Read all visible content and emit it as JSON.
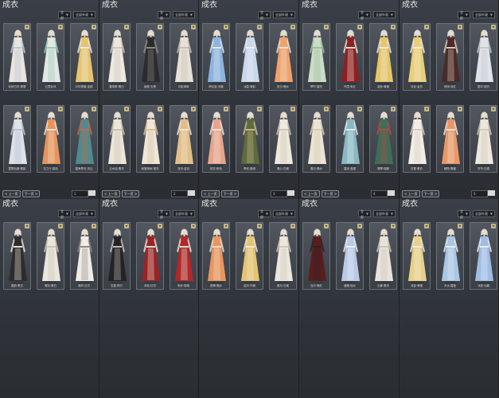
{
  "panel_title": "成衣",
  "filter_left": "全部",
  "filter_right": "全部外观",
  "pager": {
    "prev": "< 上一页",
    "next": "下一页 >"
  },
  "panels": [
    {
      "page_num": "1",
      "items": [
        {
          "name": "仙侠白衣·素雪",
          "dress": "#e9e4dc",
          "accent": "#b9c7d6",
          "badge": "★"
        },
        {
          "name": "云霞仙衣",
          "dress": "#dfe9e2",
          "accent": "#9fc9b6",
          "badge": "★"
        },
        {
          "name": "月华霓裳·金缕",
          "dress": "#e6c470",
          "accent": "#f0ece2",
          "badge": "★"
        },
        {
          "name": "霜雪仙裳·素影",
          "dress": "#dde2ea",
          "accent": "#b8c1cf",
          "badge": "★"
        },
        {
          "name": "花之行·暮色",
          "dress": "#e7945c",
          "accent": "#f1e4d2",
          "badge": "★"
        },
        {
          "name": "碧海青天·流云",
          "dress": "#4f8b8e",
          "accent": "#c36a4a",
          "badge": "★"
        }
      ]
    },
    {
      "page_num": "2",
      "items": [
        {
          "name": "春风醉·素白",
          "dress": "#ede8e0",
          "accent": "#cfc6b8",
          "badge": "★"
        },
        {
          "name": "幽夜·玄黑",
          "dress": "#2b2b2f",
          "accent": "#8e8a82",
          "badge": "★"
        },
        {
          "name": "月影清辉",
          "dress": "#e6e1d8",
          "accent": "#c7bfb3",
          "badge": "★"
        },
        {
          "name": "云水谣·素衣",
          "dress": "#ece6da",
          "accent": "#cdbfa8",
          "badge": "★"
        },
        {
          "name": "雨落清秋·锦衣",
          "dress": "#efe6d8",
          "accent": "#d8c09a",
          "badge": "★"
        },
        {
          "name": "流光·金羽",
          "dress": "#e2bf8a",
          "accent": "#f3e7d3",
          "badge": "★"
        }
      ]
    },
    {
      "page_num": "3",
      "items": [
        {
          "name": "晴空蓝·浅裳",
          "dress": "#8db4df",
          "accent": "#dfe8f2",
          "badge": "★"
        },
        {
          "name": "冰霜·清影",
          "dress": "#c9d7ea",
          "accent": "#edf1f6",
          "badge": "★"
        },
        {
          "name": "夏日·橙纱",
          "dress": "#efa26c",
          "accent": "#f3e2cf",
          "badge": "★"
        },
        {
          "name": "桃花·粉色",
          "dress": "#e7a48d",
          "accent": "#f4e5da",
          "badge": "★"
        },
        {
          "name": "青松·墨绿",
          "dress": "#5f6a3d",
          "accent": "#c9b993",
          "badge": "★"
        },
        {
          "name": "素心·白裳",
          "dress": "#eee8dd",
          "accent": "#cfc4b3",
          "badge": "★"
        }
      ]
    },
    {
      "page_num": "4",
      "items": [
        {
          "name": "翠竹·碧衣",
          "dress": "#cbdcc8",
          "accent": "#9fbf9a",
          "badge": "★"
        },
        {
          "name": "丹霞·朱红",
          "dress": "#8e1f22",
          "accent": "#e7ddd0",
          "badge": "★"
        },
        {
          "name": "金秋·黄裳",
          "dress": "#e6c66a",
          "accent": "#f1eadc",
          "badge": "★"
        },
        {
          "name": "春日·素纱",
          "dress": "#ebe4d6",
          "accent": "#d7c9ae",
          "badge": "★"
        },
        {
          "name": "碧波·蓝裙",
          "dress": "#8ab8c2",
          "accent": "#e1edf0",
          "badge": "★"
        },
        {
          "name": "翡翠·锦服",
          "dress": "#3d6e5a",
          "accent": "#b84a3c",
          "badge": "★"
        }
      ]
    },
    {
      "page_num": "5",
      "items": [
        {
          "name": "月桂·金衣",
          "dress": "#e8cf78",
          "accent": "#f4ecd9",
          "badge": "★"
        },
        {
          "name": "夜雨·深红",
          "dress": "#4b2a2a",
          "accent": "#d9c8b5",
          "badge": "★"
        },
        {
          "name": "霜华·银衣",
          "dress": "#dfe2e6",
          "accent": "#c4c9d0",
          "badge": "★"
        },
        {
          "name": "白雪·素衣",
          "dress": "#f1ede6",
          "accent": "#d5cdbf",
          "badge": "★"
        },
        {
          "name": "朝阳·橙裳",
          "dress": "#e89868",
          "accent": "#f3e3d0",
          "badge": "★"
        },
        {
          "name": "芳华·白裙",
          "dress": "#ece6dd",
          "accent": "#d2c7b6",
          "badge": "★"
        }
      ]
    },
    {
      "page_num": "",
      "items": [
        {
          "name": "墨韵·黑白",
          "dress": "#2d2b2b",
          "accent": "#e6e0d6",
          "badge": "★"
        },
        {
          "name": "雪羽·素白",
          "dress": "#ebe6dd",
          "accent": "#cbc2b3",
          "badge": "★"
        },
        {
          "name": "清风·白衣",
          "dress": "#f0ece5",
          "accent": "#8e8a82",
          "badge": "★"
        }
      ]
    },
    {
      "page_num": "",
      "items": [
        {
          "name": "玄墨·夜行",
          "dress": "#232325",
          "accent": "#c2bdb4",
          "badge": "★"
        },
        {
          "name": "赤焰·红衣",
          "dress": "#9a2326",
          "accent": "#ece3d6",
          "badge": "★"
        },
        {
          "name": "朱砂·锦袍",
          "dress": "#b3262a",
          "accent": "#e9dfcf",
          "badge": "★"
        }
      ]
    },
    {
      "page_num": "",
      "items": [
        {
          "name": "夏蝉·橙纱",
          "dress": "#e9955e",
          "accent": "#f1e0cb",
          "badge": "★"
        },
        {
          "name": "金凤·华服",
          "dress": "#e3c471",
          "accent": "#f2ead9",
          "badge": "★"
        },
        {
          "name": "素月·白裳",
          "dress": "#ece7de",
          "accent": "#d1c6b5",
          "badge": "★"
        }
      ]
    },
    {
      "page_num": "",
      "items": [
        {
          "name": "血月·暗红",
          "dress": "#5a1d1f",
          "accent": "#2b2526",
          "badge": "★"
        },
        {
          "name": "蓝蝶·轻纱",
          "dress": "#b9c9e6",
          "accent": "#eef1f7",
          "badge": "★"
        },
        {
          "name": "云裳·素衣",
          "dress": "#e7e3dc",
          "accent": "#cdc4b5",
          "badge": "★"
        }
      ]
    },
    {
      "page_num": "",
      "items": [
        {
          "name": "流金·黄裙",
          "dress": "#e9d08a",
          "accent": "#f4edde",
          "badge": "★"
        },
        {
          "name": "天水·碧蓝",
          "dress": "#a9c6e2",
          "accent": "#e5eef6",
          "badge": "★"
        },
        {
          "name": "冰蓝·仙裳",
          "dress": "#9fbde3",
          "accent": "#e7eef7",
          "badge": "★"
        }
      ]
    }
  ]
}
